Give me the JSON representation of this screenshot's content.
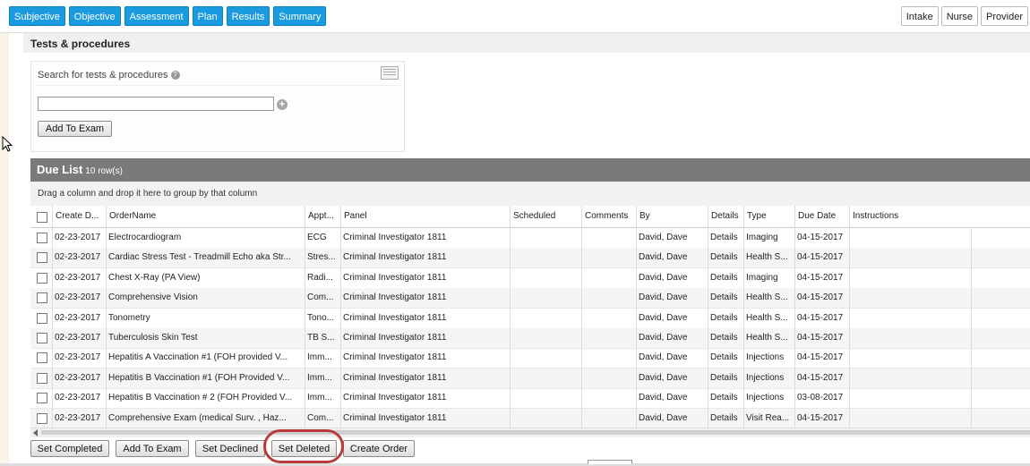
{
  "tabs": [
    "Subjective",
    "Objective",
    "Assessment",
    "Plan",
    "Results",
    "Summary"
  ],
  "right_tabs": [
    "Intake",
    "Nurse",
    "Provider"
  ],
  "section_title": "Tests & procedures",
  "search": {
    "label": "Search for tests & procedures",
    "value": "",
    "add_button": "Add To Exam"
  },
  "due_list": {
    "title": "Due List",
    "count": "10 row(s)",
    "group_hint": "Drag a column and drop it here to group by that column",
    "columns": [
      "Create D...",
      "OrderName",
      "Appt...",
      "Panel",
      "Scheduled",
      "Comments",
      "By",
      "Details",
      "Type",
      "Due Date",
      "Instructions"
    ],
    "rows": [
      [
        "02-23-2017",
        "Electrocardiogram",
        "ECG",
        "Criminal Investigator 1811",
        "",
        "",
        "David, Dave",
        "Details",
        "Imaging",
        "04-15-2017",
        ""
      ],
      [
        "02-23-2017",
        "Cardiac Stress Test - Treadmill Echo aka Str...",
        "Stres...",
        "Criminal Investigator 1811",
        "",
        "",
        "David, Dave",
        "Details",
        "Health S...",
        "04-15-2017",
        ""
      ],
      [
        "02-23-2017",
        "Chest X-Ray (PA View)",
        "Radi...",
        "Criminal Investigator 1811",
        "",
        "",
        "David, Dave",
        "Details",
        "Imaging",
        "04-15-2017",
        ""
      ],
      [
        "02-23-2017",
        "Comprehensive Vision",
        "Com...",
        "Criminal Investigator 1811",
        "",
        "",
        "David, Dave",
        "Details",
        "Health S...",
        "04-15-2017",
        ""
      ],
      [
        "02-23-2017",
        "Tonometry",
        "Tono...",
        "Criminal Investigator 1811",
        "",
        "",
        "David, Dave",
        "Details",
        "Health S...",
        "04-15-2017",
        ""
      ],
      [
        "02-23-2017",
        "Tuberculosis Skin Test",
        "TB S...",
        "Criminal Investigator 1811",
        "",
        "",
        "David, Dave",
        "Details",
        "Health S...",
        "04-15-2017",
        ""
      ],
      [
        "02-23-2017",
        "Hepatitis A Vaccination #1 (FOH provided V...",
        "Imm...",
        "Criminal Investigator 1811",
        "",
        "",
        "David, Dave",
        "Details",
        "Injections",
        "04-15-2017",
        ""
      ],
      [
        "02-23-2017",
        "Hepatitis B Vaccination #1 (FOH Provided V...",
        "Imm...",
        "Criminal Investigator 1811",
        "",
        "",
        "David, Dave",
        "Details",
        "Injections",
        "04-15-2017",
        ""
      ],
      [
        "02-23-2017",
        "Hepatitis B Vaccination # 2 (FOH Provided V...",
        "Imm...",
        "Criminal Investigator 1811",
        "",
        "",
        "David, Dave",
        "Details",
        "Injections",
        "03-08-2017",
        ""
      ],
      [
        "02-23-2017",
        "Comprehensive Exam (medical Surv. , Haz...",
        "Com...",
        "Criminal Investigator 1811",
        "",
        "",
        "David, Dave",
        "Details",
        "Visit Rea...",
        "04-15-2017",
        ""
      ]
    ]
  },
  "actions": [
    "Set Completed",
    "Add To Exam",
    "Set Declined",
    "Set Deleted",
    "Create Order"
  ],
  "colors": {
    "tab_blue": "#1a9be0",
    "due_header": "#7a7a7a",
    "highlight": "#b83a3a"
  }
}
